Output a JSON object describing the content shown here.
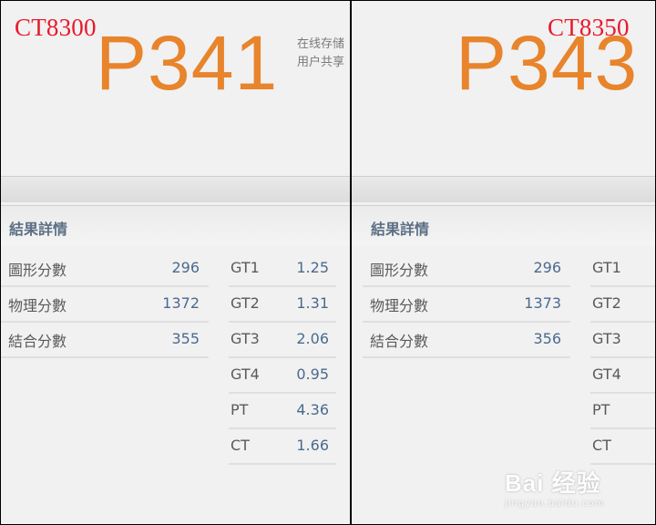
{
  "left": {
    "label": "CT8300",
    "score": "P341",
    "intro_lines": [
      "在线存储",
      "用户共享"
    ],
    "section_title": "結果詳情",
    "summary": [
      {
        "name": "圖形分數",
        "value": "296"
      },
      {
        "name": "物理分數",
        "value": "1372"
      },
      {
        "name": "結合分數",
        "value": "355"
      }
    ],
    "details": [
      {
        "name": "GT1",
        "value": "1.25"
      },
      {
        "name": "GT2",
        "value": "1.31"
      },
      {
        "name": "GT3",
        "value": "2.06"
      },
      {
        "name": "GT4",
        "value": "0.95"
      },
      {
        "name": "PT",
        "value": "4.36"
      },
      {
        "name": "CT",
        "value": "1.66"
      }
    ]
  },
  "right": {
    "label": "CT8350",
    "score": "P343",
    "section_title": "結果詳情",
    "summary": [
      {
        "name": "圖形分數",
        "value": "296"
      },
      {
        "name": "物理分數",
        "value": "1373"
      },
      {
        "name": "結合分數",
        "value": "356"
      }
    ],
    "details": [
      {
        "name": "GT1",
        "value": ""
      },
      {
        "name": "GT2",
        "value": ""
      },
      {
        "name": "GT3",
        "value": ""
      },
      {
        "name": "GT4",
        "value": ""
      },
      {
        "name": "PT",
        "value": ""
      },
      {
        "name": "CT",
        "value": ""
      }
    ]
  },
  "watermark": {
    "logo": "Bai 经验",
    "url": "jingyan.baidu.com"
  }
}
